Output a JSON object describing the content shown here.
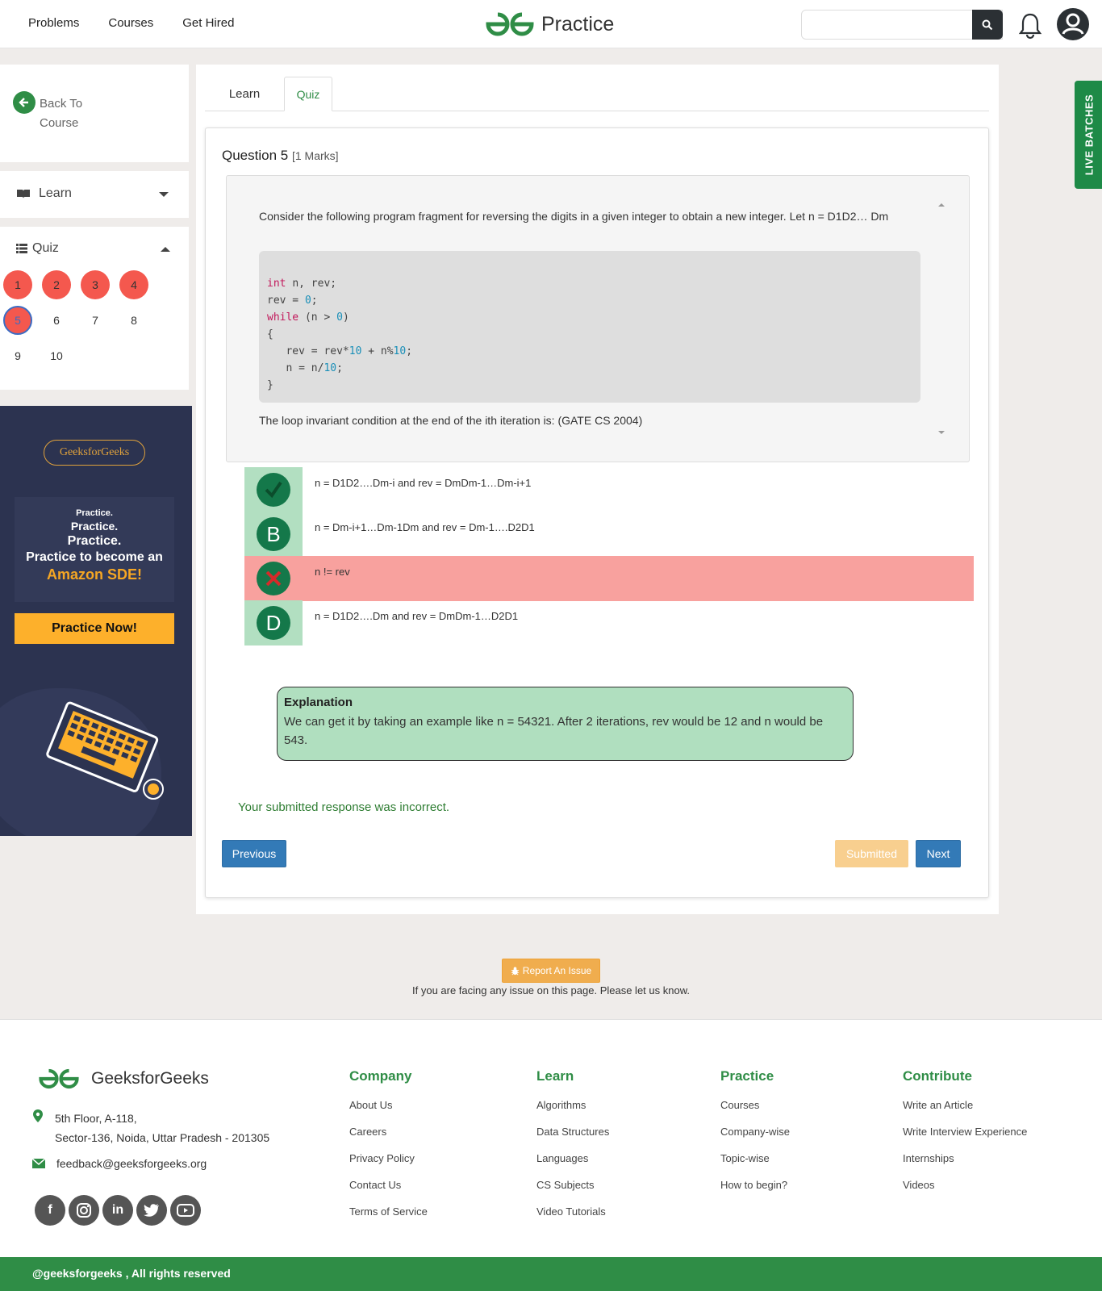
{
  "nav": {
    "links": [
      "Problems",
      "Courses",
      "Get Hired"
    ],
    "brand": "Practice",
    "search_placeholder": ""
  },
  "sidebar": {
    "back_label": "Back To Course",
    "learn_label": "Learn",
    "quiz_label": "Quiz",
    "questions": [
      {
        "n": "1",
        "state": "answered"
      },
      {
        "n": "2",
        "state": "answered"
      },
      {
        "n": "3",
        "state": "answered"
      },
      {
        "n": "4",
        "state": "answered"
      },
      {
        "n": "5",
        "state": "current"
      },
      {
        "n": "6",
        "state": "unanswered"
      },
      {
        "n": "7",
        "state": "unanswered"
      },
      {
        "n": "8",
        "state": "unanswered"
      },
      {
        "n": "9",
        "state": "unanswered"
      },
      {
        "n": "10",
        "state": "unanswered"
      }
    ]
  },
  "ad": {
    "brand": "GeeksforGeeks",
    "line1": "Practice.",
    "line2": "Practice.",
    "line3": "Practice.",
    "line4": "Practice to become an",
    "line5": "Amazon SDE!",
    "cta": "Practice Now!"
  },
  "tabs": {
    "learn": "Learn",
    "quiz": "Quiz"
  },
  "question": {
    "title": "Question 5",
    "marks": "[1 Marks]",
    "intro": "Consider the following program fragment for reversing the digits in a given integer to obtain a new integer. Let n = D1D2… Dm",
    "code": [
      "int n, rev;",
      "rev = 0;",
      "while (n > 0)",
      "{",
      "   rev = rev*10 + n%10;",
      "   n = n/10;",
      "}"
    ],
    "outro": "The loop invariant condition at the end of the ith iteration is: (GATE CS 2004)"
  },
  "options": [
    {
      "letter": "A",
      "icon": "check-icon",
      "text": "n = D1D2….Dm-i and rev = DmDm-1…Dm-i+1",
      "status": "correct"
    },
    {
      "letter": "B",
      "icon": "",
      "text": "n = Dm-i+1…Dm-1Dm and rev = Dm-1….D2D1",
      "status": "neutral"
    },
    {
      "letter": "C",
      "icon": "cross-icon",
      "text": "n != rev",
      "status": "selected-wrong"
    },
    {
      "letter": "D",
      "icon": "",
      "text": "n = D1D2….Dm and rev = DmDm-1…D2D1",
      "status": "neutral"
    }
  ],
  "explanation": {
    "heading": "Explanation",
    "text": "We can get it by taking an example like n = 54321. After 2 iterations, rev would be 12 and n would be 543."
  },
  "result_text": "Your submitted response was incorrect.",
  "buttons": {
    "previous": "Previous",
    "submitted": "Submitted",
    "next": "Next"
  },
  "live_batches": "LIVE  BATCHES",
  "report": {
    "button": "Report An Issue",
    "note": "If you are facing any issue on this page. Please let us know."
  },
  "footer": {
    "brand": "GeeksforGeeks",
    "address_line1": "5th Floor, A-118,",
    "address_line2": "Sector-136, Noida, Uttar Pradesh - 201305",
    "email": "feedback@geeksforgeeks.org",
    "social": [
      "facebook-icon",
      "instagram-icon",
      "linkedin-icon",
      "twitter-icon",
      "youtube-icon"
    ],
    "columns": [
      {
        "heading": "Company",
        "items": [
          "About Us",
          "Careers",
          "Privacy Policy",
          "Contact Us",
          "Terms of Service"
        ]
      },
      {
        "heading": "Learn",
        "items": [
          "Algorithms",
          "Data Structures",
          "Languages",
          "CS Subjects",
          "Video Tutorials"
        ]
      },
      {
        "heading": "Practice",
        "items": [
          "Courses",
          "Company-wise",
          "Topic-wise",
          "How to begin?"
        ]
      },
      {
        "heading": "Contribute",
        "items": [
          "Write an Article",
          "Write Interview Experience",
          "Internships",
          "Videos"
        ]
      }
    ],
    "copyright": "@geeksforgeeks , All rights reserved"
  },
  "colors": {
    "brand_green": "#2f8d46",
    "wrong_bg": "#f8a19e",
    "option_badge": "#b2dfc1",
    "explanation_bg": "#b0dfbf"
  }
}
